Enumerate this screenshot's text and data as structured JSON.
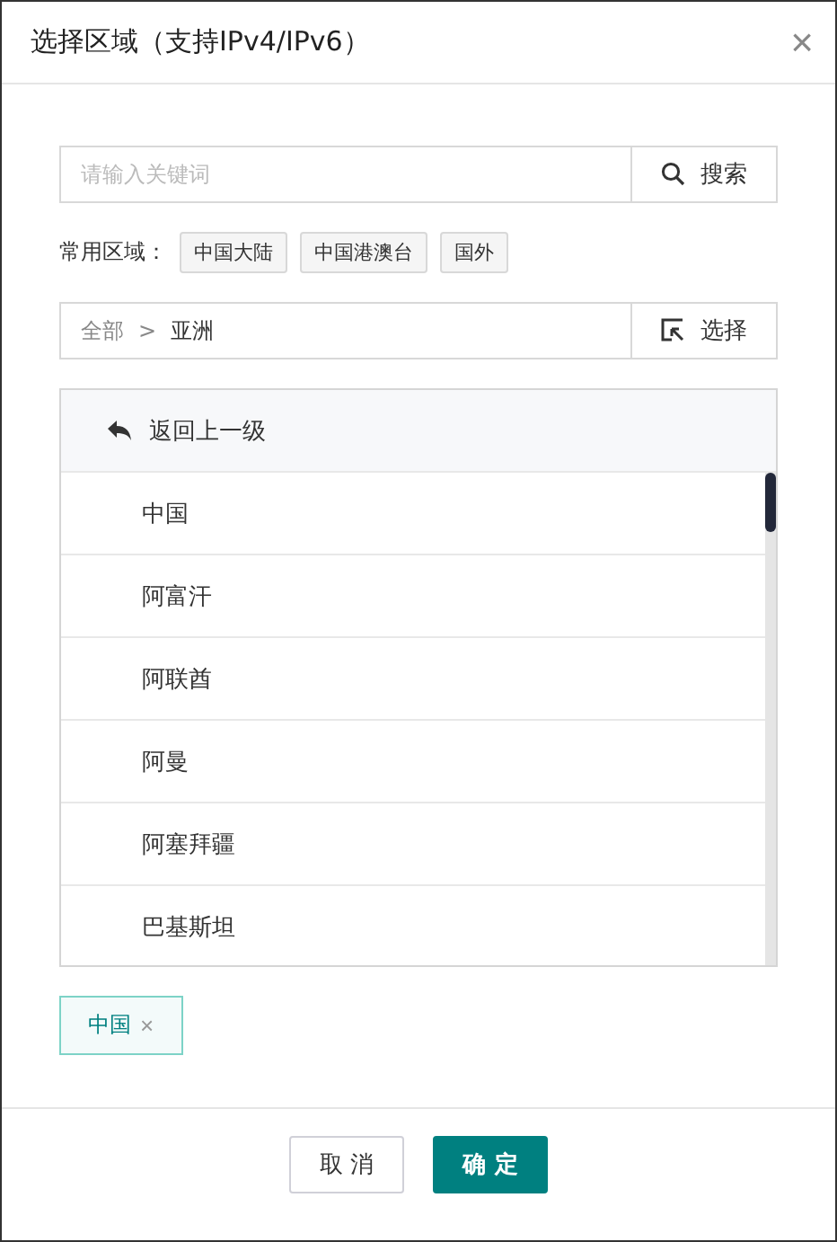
{
  "window": {
    "title": "选择区域（支持IPv4/IPv6）",
    "close": "×"
  },
  "search": {
    "placeholder": "请输入关键词",
    "button": "搜索"
  },
  "common_regions": {
    "label": "常用区域：",
    "items": [
      "中国大陆",
      "中国港澳台",
      "国外"
    ]
  },
  "breadcrumb": {
    "items": [
      "全部",
      "亚洲"
    ],
    "separator": ">",
    "button": "选择"
  },
  "list": {
    "back": "返回上一级",
    "items": [
      "中国",
      "阿富汗",
      "阿联酋",
      "阿曼",
      "阿塞拜疆",
      "巴基斯坦"
    ]
  },
  "selected_tags": [
    {
      "label": "中国",
      "remove": "×"
    }
  ],
  "buttons": [
    {
      "label": "取 消",
      "kind": "secondary"
    },
    {
      "label": "确 定",
      "kind": "primary"
    }
  ]
}
